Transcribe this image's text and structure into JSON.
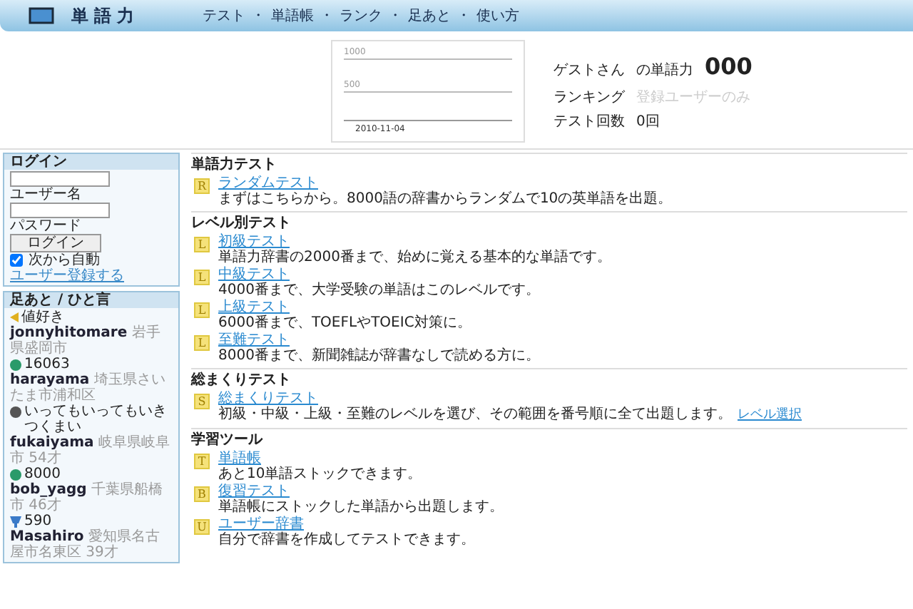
{
  "header": {
    "title": "単語力",
    "nav": [
      "テスト",
      "単語帳",
      "ランク",
      "足あと",
      "使い方"
    ],
    "separator": "・"
  },
  "chart": {
    "ytick_labels": [
      "1000",
      "500"
    ],
    "xtick_label": "2010-11-04"
  },
  "profile": {
    "user": "ゲストさん",
    "label": "の単語力",
    "score": "000",
    "ranking_label": "ランキング",
    "ranking_value": "登録ユーザーのみ",
    "count_label": "テスト回数",
    "count_value": "0回"
  },
  "login": {
    "title": "ログイン",
    "username_label": "ユーザー名",
    "password_label": "パスワード",
    "button": "ログイン",
    "remember": {
      "label": "次から自動",
      "checked": true
    },
    "register_link": "ユーザー登録する"
  },
  "footprints": {
    "title": "足あと / ひと言",
    "entries": [
      {
        "kind": "arrow",
        "text": "値好き"
      },
      {
        "kind": "user",
        "name": "jonnyhitomare",
        "info": "岩手県盛岡市"
      },
      {
        "kind": "score",
        "text": "16063"
      },
      {
        "kind": "user",
        "name": "harayama",
        "info": "埼玉県さいたま市浦和区"
      },
      {
        "kind": "comment",
        "text": "いってもいってもいきつくまい"
      },
      {
        "kind": "user",
        "name": "fukaiyama",
        "info": "岐阜県岐阜市 54才"
      },
      {
        "kind": "score",
        "text": "8000"
      },
      {
        "kind": "user",
        "name": "bob_yagg",
        "info": "千葉県船橋市 46才"
      },
      {
        "kind": "rank",
        "text": "590"
      },
      {
        "kind": "user",
        "name": "Masahiro",
        "info": "愛知県名古屋市名東区 39才"
      }
    ]
  },
  "sections": [
    {
      "title": "単語力テスト",
      "items": [
        {
          "badge": "R",
          "title": "ランダムテスト",
          "desc": "まずはこちらから。8000語の辞書からランダムで10の英単語を出題。"
        }
      ]
    },
    {
      "title": "レベル別テスト",
      "items": [
        {
          "badge": "L",
          "title": "初級テスト",
          "desc": "単語力辞書の2000番まで、始めに覚える基本的な単語です。"
        },
        {
          "badge": "L",
          "title": "中級テスト",
          "desc": "4000番まで、大学受験の単語はこのレベルです。"
        },
        {
          "badge": "L",
          "title": "上級テスト",
          "desc": "6000番まで、TOEFLやTOEIC対策に。"
        },
        {
          "badge": "L",
          "title": "至難テスト",
          "desc": "8000番まで、新聞雑誌が辞書なしで読める方に。"
        }
      ]
    },
    {
      "title": "総まくりテスト",
      "items": [
        {
          "badge": "S",
          "title": "総まくりテスト",
          "desc": "初級・中級・上級・至難のレベルを選び、その範囲を番号順に全て出題します。",
          "link": "レベル選択"
        }
      ]
    },
    {
      "title": "学習ツール",
      "items": [
        {
          "badge": "T",
          "title": "単語帳",
          "desc": "あと10単語ストックできます。"
        },
        {
          "badge": "B",
          "title": "復習テスト",
          "desc": "単語帳にストックした単語から出題します。"
        },
        {
          "badge": "U",
          "title": "ユーザー辞書",
          "desc": "自分で辞書を作成してテストできます。"
        }
      ]
    }
  ]
}
